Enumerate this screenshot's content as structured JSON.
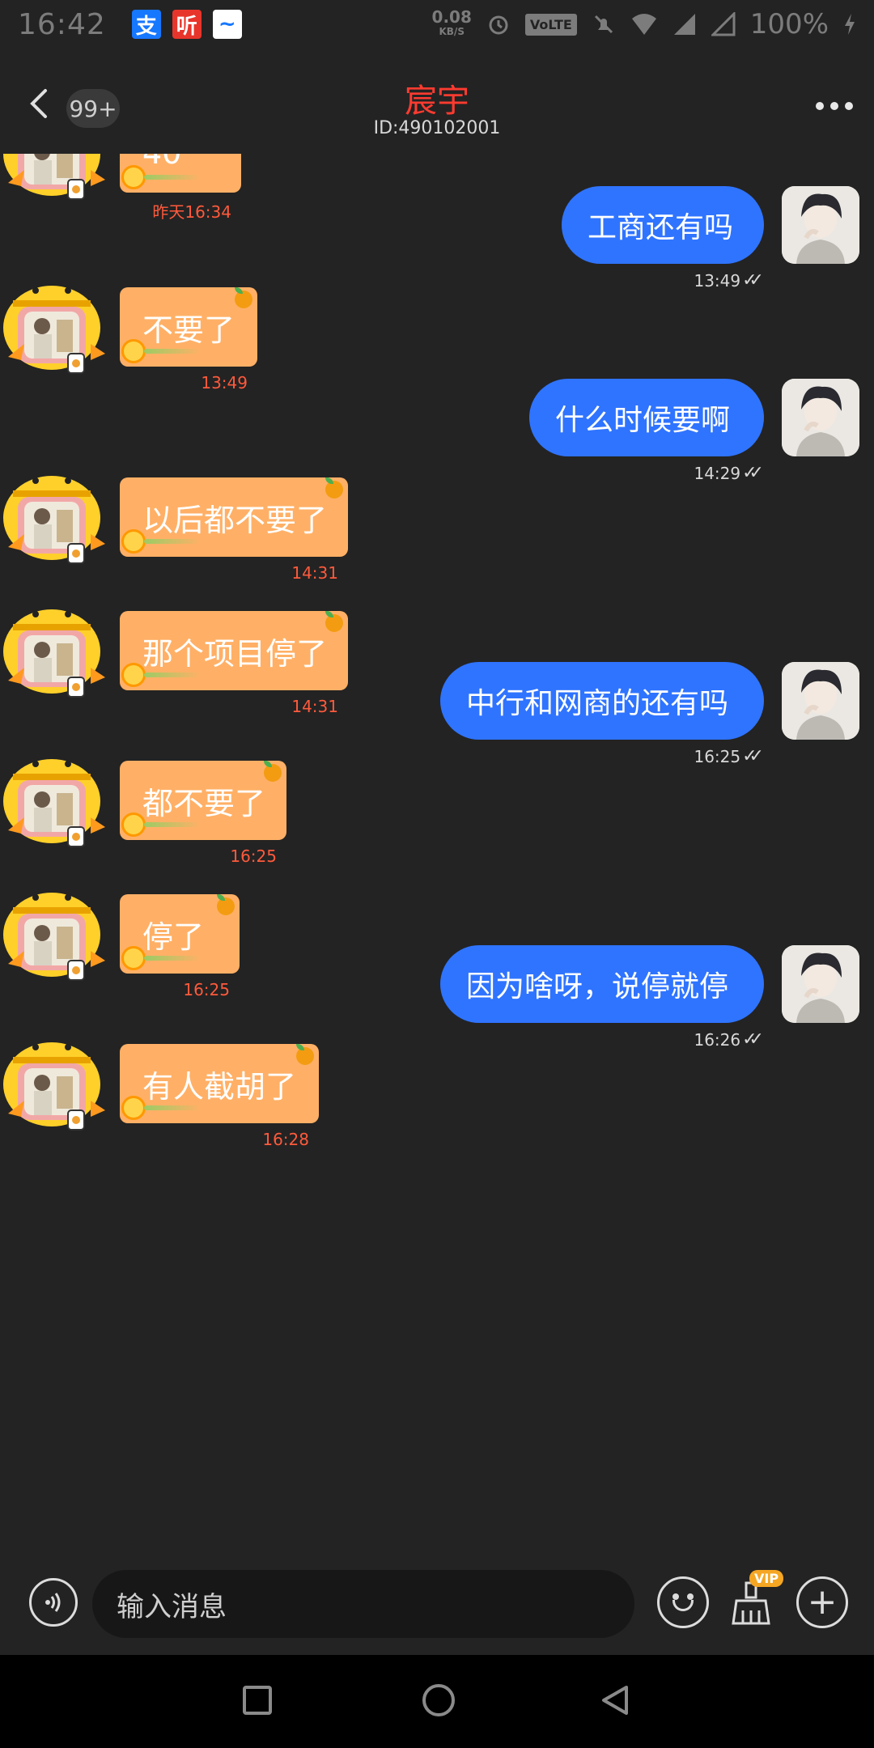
{
  "status_bar": {
    "time": "16:42",
    "apps": [
      "支",
      "听",
      "~"
    ],
    "net_speed": "0.08",
    "net_unit": "KB/S",
    "volte": "VoLTE",
    "battery": "100%"
  },
  "header": {
    "unread_badge": "99+",
    "title": "宸宇",
    "subtitle": "ID:490102001"
  },
  "messages": [
    {
      "side": "left",
      "text": "40",
      "time": "昨天16:34"
    },
    {
      "side": "right",
      "text": "工商还有吗",
      "time": "13:49"
    },
    {
      "side": "left",
      "text": "不要了",
      "time": "13:49"
    },
    {
      "side": "right",
      "text": "什么时候要啊",
      "time": "14:29"
    },
    {
      "side": "left",
      "text": "以后都不要了",
      "time": "14:31"
    },
    {
      "side": "left",
      "text": "那个项目停了",
      "time": "14:31"
    },
    {
      "side": "right",
      "text": "中行和网商的还有吗",
      "time": "16:25"
    },
    {
      "side": "left",
      "text": "都不要了",
      "time": "16:25"
    },
    {
      "side": "left",
      "text": "停了",
      "time": "16:25"
    },
    {
      "side": "right",
      "text": "因为啥呀，说停就停",
      "time": "16:26"
    },
    {
      "side": "left",
      "text": "有人截胡了",
      "time": "16:28"
    }
  ],
  "input_bar": {
    "placeholder": "输入消息",
    "vip_label": "VIP"
  },
  "colors": {
    "background": "#232323",
    "left_bubble": "#ffb066",
    "right_bubble": "#2f74ff",
    "title": "#ff3b30",
    "left_time": "#ff5a3c"
  }
}
